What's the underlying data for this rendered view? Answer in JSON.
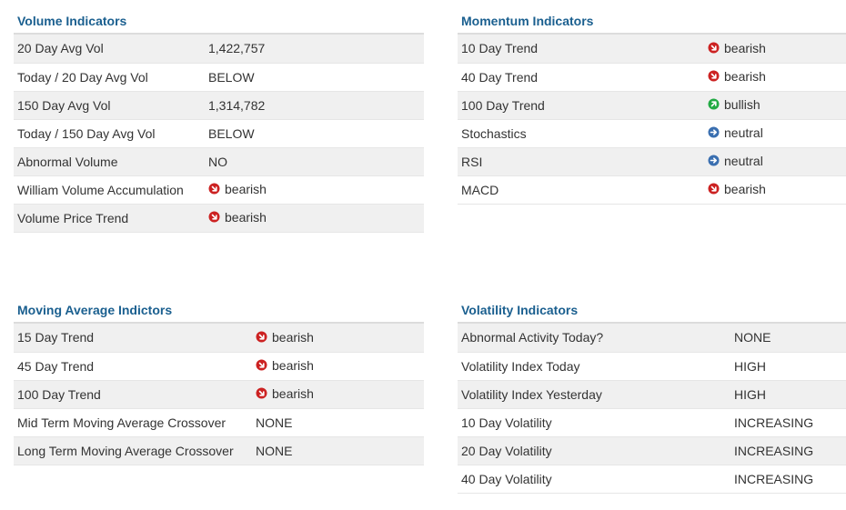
{
  "volume": {
    "title": "Volume Indicators",
    "rows": [
      {
        "label": "20 Day Avg Vol",
        "value": "1,422,757",
        "icon": ""
      },
      {
        "label": "Today / 20 Day Avg Vol",
        "value": "BELOW",
        "icon": ""
      },
      {
        "label": "150 Day Avg Vol",
        "value": "1,314,782",
        "icon": ""
      },
      {
        "label": "Today / 150 Day Avg Vol",
        "value": "BELOW",
        "icon": ""
      },
      {
        "label": "Abnormal Volume",
        "value": "NO",
        "icon": ""
      },
      {
        "label": "William Volume Accumulation",
        "value": "bearish",
        "icon": "bearish"
      },
      {
        "label": "Volume Price Trend",
        "value": "bearish",
        "icon": "bearish"
      }
    ]
  },
  "momentum": {
    "title": "Momentum Indicators",
    "rows": [
      {
        "label": "10 Day Trend",
        "value": "bearish",
        "icon": "bearish"
      },
      {
        "label": "40 Day Trend",
        "value": "bearish",
        "icon": "bearish"
      },
      {
        "label": "100 Day Trend",
        "value": "bullish",
        "icon": "bullish"
      },
      {
        "label": "Stochastics",
        "value": "neutral",
        "icon": "neutral"
      },
      {
        "label": "RSI",
        "value": "neutral",
        "icon": "neutral"
      },
      {
        "label": "MACD",
        "value": "bearish",
        "icon": "bearish"
      }
    ]
  },
  "moving_average": {
    "title": "Moving Average Indictors",
    "rows": [
      {
        "label": "15 Day Trend",
        "value": "bearish",
        "icon": "bearish"
      },
      {
        "label": "45 Day Trend",
        "value": "bearish",
        "icon": "bearish"
      },
      {
        "label": "100 Day Trend",
        "value": "bearish",
        "icon": "bearish"
      },
      {
        "label": "Mid Term Moving Average Crossover",
        "value": "NONE",
        "icon": ""
      },
      {
        "label": "Long Term Moving Average Crossover",
        "value": "NONE",
        "icon": ""
      }
    ]
  },
  "volatility": {
    "title": "Volatility Indicators",
    "rows": [
      {
        "label": "Abnormal Activity Today?",
        "value": "NONE",
        "icon": ""
      },
      {
        "label": "Volatility Index Today",
        "value": "HIGH",
        "icon": ""
      },
      {
        "label": "Volatility Index Yesterday",
        "value": "HIGH",
        "icon": ""
      },
      {
        "label": "10 Day Volatility",
        "value": "INCREASING",
        "icon": ""
      },
      {
        "label": "20 Day Volatility",
        "value": "INCREASING",
        "icon": ""
      },
      {
        "label": "40 Day Volatility",
        "value": "INCREASING",
        "icon": ""
      }
    ]
  },
  "colors": {
    "title": "#1a5f8f",
    "bearish": "#cc2222",
    "bullish": "#22aa44",
    "neutral": "#3a6fb0"
  }
}
